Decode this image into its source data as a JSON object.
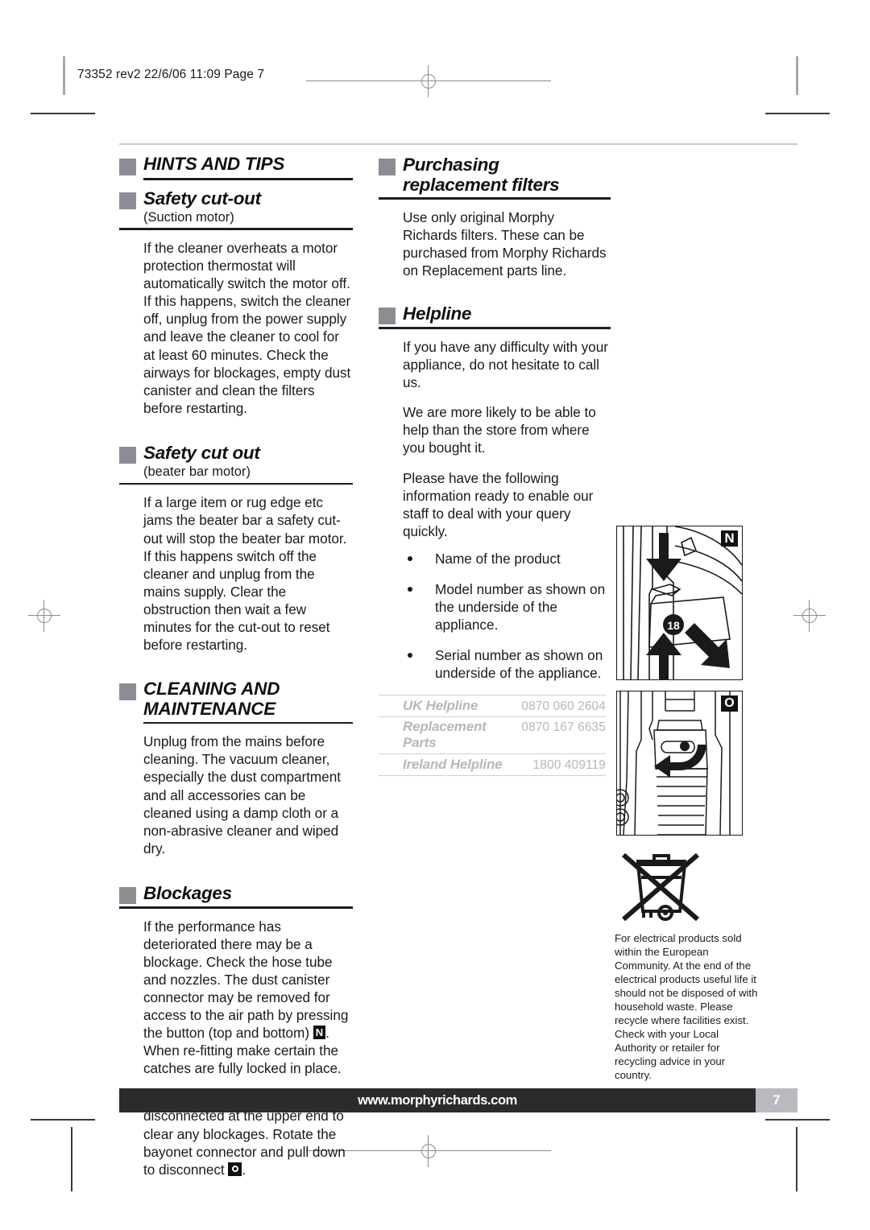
{
  "printer_slug": "73352 rev2  22/6/06  11:09  Page 7",
  "left_column": {
    "section1": {
      "heading": "HINTS AND TIPS",
      "sub_heading": "Safety cut-out",
      "sub_note": "(Suction motor)",
      "body": "If the cleaner overheats a motor protection thermostat will automatically switch the motor off. If this happens, switch the cleaner off, unplug from the power supply and leave the cleaner to cool for at least 60 minutes. Check the airways for blockages, empty dust canister and clean the filters before restarting."
    },
    "section2": {
      "heading": "Safety cut out",
      "sub_note": "(beater bar motor)",
      "body": "If a large item or rug edge etc jams the beater bar a safety cut-out will stop the beater bar motor. If this happens switch off the cleaner and unplug from the mains supply. Clear the obstruction then wait a few minutes for the cut-out to reset before restarting."
    },
    "section3": {
      "heading": "CLEANING AND MAINTENANCE",
      "body": "Unplug from the mains before cleaning. The vacuum cleaner, especially the dust compartment and all accessories can be cleaned using a damp cloth or a non-abrasive cleaner and wiped dry."
    },
    "section4": {
      "heading": "Blockages",
      "body_part1": "If the performance has deteriorated there may be a blockage. Check the hose tube and nozzles. The dust canister connector may be removed for access to the air path by pressing the button (top and bottom) ",
      "ref1": "N",
      "body_part2": ". When re-fitting make certain the catches are fully locked in place.",
      "body2_part1": "The floor nozzle tube may also be disconnected at the upper end to clear any blockages. Rotate the bayonet connector and pull down to disconnect ",
      "ref2": "O",
      "body2_part2": "."
    }
  },
  "right_column": {
    "section1": {
      "heading_line1": "Purchasing",
      "heading_line2": "replacement filters",
      "body": "Use only original Morphy Richards filters. These can be purchased from Morphy Richards on Replacement parts line."
    },
    "section2": {
      "heading": "Helpline",
      "body1": "If you have any difficulty with your appliance, do not hesitate to call us.",
      "body2": "We are more likely to be able to help than the store from where you bought it.",
      "body3": "Please have the following information ready to enable our staff to deal with your query quickly.",
      "bullets": [
        "Name of the product",
        "Model number as shown on the underside of the appliance.",
        "Serial number as shown on underside of the appliance."
      ]
    },
    "helpline_table": {
      "rows": [
        {
          "label": "UK Helpline",
          "number": "0870 060 2604"
        },
        {
          "label": "Replacement Parts",
          "number": "0870 167 6635"
        },
        {
          "label": "Ireland Helpline",
          "number": "1800 409119"
        }
      ]
    }
  },
  "figures": {
    "fig_n": {
      "tag": "N",
      "callout": "18",
      "caption": "dust canister release illustration"
    },
    "fig_o": {
      "tag": "O",
      "caption": "bayonet connector rotation illustration"
    },
    "weee": {
      "symbol": "crossed-out-wheelie-bin",
      "text": "For electrical products sold within the European Community. At the end of the electrical products useful life it should not be disposed of with household waste. Please recycle where facilities exist. Check with your Local Authority or retailer for recycling advice in your country."
    }
  },
  "footer": {
    "website": "www.morphyrichards.com",
    "page_number": "7"
  },
  "colors": {
    "heading_square": "#8c8c94",
    "rule": "#211a22",
    "footer_bar": "#2b2b2b",
    "footer_page_box": "#b9b9bf",
    "helpline_text": "#b7b7bd"
  }
}
